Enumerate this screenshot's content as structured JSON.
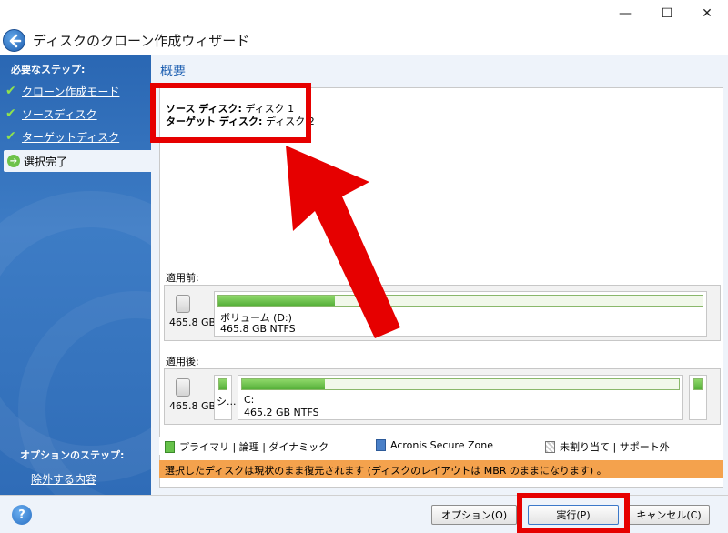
{
  "window": {
    "title": "ディスクのクローン作成ウィザード",
    "min_glyph": "—",
    "max_glyph": "☐",
    "close_glyph": "✕"
  },
  "sidebar": {
    "heading": "必要なステップ:",
    "steps": [
      {
        "label": "クローン作成モード",
        "done": true
      },
      {
        "label": "ソースディスク",
        "done": true
      },
      {
        "label": "ターゲットディスク",
        "done": true
      },
      {
        "label": "選択完了",
        "current": true
      }
    ],
    "options_heading": "オプションのステップ:",
    "options_link": "除外する内容",
    "check_glyph": "✔",
    "arrow_glyph": "➔"
  },
  "main": {
    "section_title": "概要",
    "summary": {
      "source_key": "ソース ディスク:",
      "source_value": "ディスク 1",
      "target_key": "ターゲット ディスク:",
      "target_value": "ディスク 2"
    },
    "before": {
      "label": "適用前:",
      "disk_size": "465.8 GB",
      "partition_name": "ボリューム (D:)",
      "partition_info": "465.8 GB  NTFS",
      "fill_fraction": 0.24
    },
    "after": {
      "label": "適用後:",
      "disk_size": "465.8 GB",
      "small_partition_name": "シ...",
      "partition_name": "C:",
      "partition_info": "465.2 GB  NTFS",
      "fill_fraction": 0.19
    },
    "legend": {
      "primary": "プライマリ | 論理 | ダイナミック",
      "secure_zone": "Acronis Secure Zone",
      "unallocated": "未割り当て | サポート外"
    },
    "notice": "選択したディスクは現状のまま復元されます (ディスクのレイアウトは MBR のままになります) 。"
  },
  "footer": {
    "help_glyph": "?",
    "options_button": "オプション(O)",
    "run_button": "実行(P)",
    "cancel_button": "キャンセル(C)"
  },
  "colors": {
    "accent_blue": "#1d5fb1",
    "sidebar_blue": "#2f6cb7",
    "callout_red": "#e60000",
    "notice_orange": "#f4a24d",
    "partition_green": "#66c24a"
  }
}
